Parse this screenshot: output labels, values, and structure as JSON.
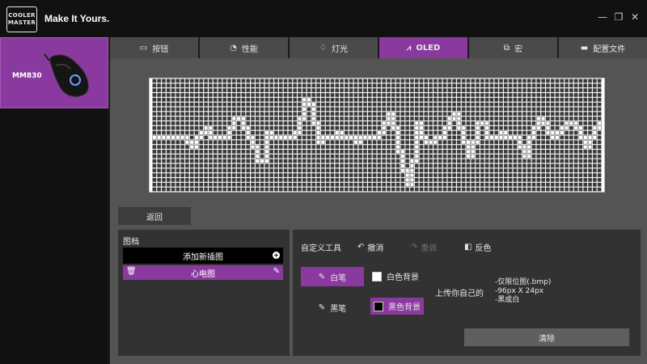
{
  "brand": {
    "logo_line1": "COOLER",
    "logo_line2": "MASTER",
    "tagline": "Make It Yours."
  },
  "window_controls": {
    "minimize": "—",
    "restore": "❐",
    "close": "✕"
  },
  "device": {
    "name": "MM830"
  },
  "tabs": [
    {
      "label": "按钮",
      "icon": "mouse-buttons-icon"
    },
    {
      "label": "性能",
      "icon": "gauge-icon"
    },
    {
      "label": "灯光",
      "icon": "bulb-icon"
    },
    {
      "label": "OLED",
      "icon": "oled-icon",
      "active": true
    },
    {
      "label": "宏",
      "icon": "macro-icon"
    },
    {
      "label": "配置文件",
      "icon": "profile-icon"
    }
  ],
  "oled": {
    "cols": 96,
    "rows": 24,
    "waveform": [
      12,
      12,
      12,
      12,
      12,
      12,
      12,
      12,
      12,
      12,
      12,
      12,
      12,
      12,
      13,
      14,
      14,
      14,
      13,
      12,
      12,
      11,
      10,
      10,
      11,
      12,
      13,
      12,
      11,
      12,
      12,
      12,
      12,
      11,
      10,
      9,
      8,
      7,
      8,
      9,
      10,
      11,
      12,
      13,
      14,
      15,
      17,
      19,
      17,
      14,
      12,
      11,
      12,
      12,
      12,
      12,
      13,
      12,
      12,
      12,
      12,
      12,
      12,
      11,
      10,
      8,
      6,
      5,
      4,
      3,
      5,
      7,
      9,
      11,
      13,
      14,
      12,
      11,
      12,
      12,
      12,
      12,
      11,
      10,
      11,
      12,
      12,
      12,
      12,
      12,
      12,
      13,
      12,
      12,
      12,
      12,
      11,
      12,
      12,
      12,
      12,
      12,
      11,
      10,
      9,
      8,
      7,
      8,
      10,
      13,
      15,
      17,
      19,
      21,
      22,
      20,
      17,
      14,
      11,
      9,
      10,
      12,
      12,
      13,
      14,
      13,
      13,
      12,
      12,
      12,
      11,
      10,
      9,
      8,
      7,
      7,
      7,
      8,
      10,
      12,
      13,
      15,
      16,
      15,
      13,
      11,
      9,
      8,
      9,
      11,
      12,
      12,
      12,
      12,
      12,
      12,
      11,
      11,
      11,
      12,
      12,
      12,
      12,
      12,
      13,
      14,
      15,
      16,
      15,
      13,
      12,
      11,
      10,
      9,
      8,
      8,
      9,
      10,
      11,
      11,
      12,
      12,
      11,
      11,
      10,
      10,
      10,
      9,
      9,
      9,
      9,
      10,
      11,
      12,
      13,
      14,
      13,
      12,
      11,
      10,
      10,
      9,
      9,
      9
    ]
  },
  "back_label": "返回",
  "library": {
    "title": "图档",
    "add_label": "添加新插图",
    "items": [
      {
        "label": "心电图"
      }
    ]
  },
  "tools": {
    "label": "自定义工具",
    "undo": "撤消",
    "redo": "重做",
    "invert": "反色",
    "white_pen": "白笔",
    "black_pen": "黑笔",
    "white_bg": "白色背景",
    "black_bg": "黑色背景",
    "upload_label": "上传你自己的",
    "notes": [
      "-仅限位图(.bmp)",
      "-96px X 24px",
      "-黑或白"
    ],
    "clear": "清除"
  }
}
